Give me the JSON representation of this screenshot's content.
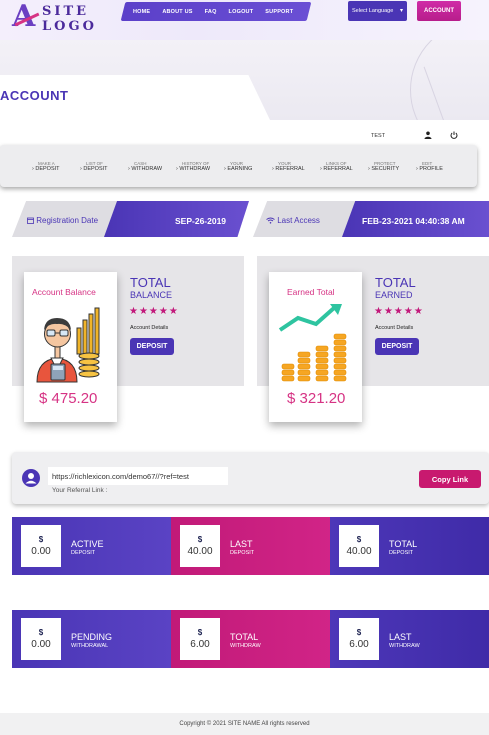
{
  "logo": {
    "mark": "A",
    "line1": "SITE",
    "line2": "LOGO"
  },
  "nav": [
    "HOME",
    "ABOUT US",
    "FAQ",
    "LOGOUT",
    "SUPPORT"
  ],
  "language": {
    "label": "Select Language",
    "caret": "▾"
  },
  "account_button": "ACCOUNT",
  "page_title": "ACCOUNT",
  "user": {
    "name": "TEST",
    "user_icon": "user-icon",
    "power_icon": "power-icon"
  },
  "submenu": [
    {
      "top": "MAKE A",
      "label": "DEPOSIT"
    },
    {
      "top": "LIST OF",
      "label": "DEPOSIT"
    },
    {
      "top": "CASH",
      "label": "WITHDRAW"
    },
    {
      "top": "HISTORY OF",
      "label": "WITHDRAW"
    },
    {
      "top": "YOUR",
      "label": "EARNING"
    },
    {
      "top": "YOUR",
      "label": "REFERRAL"
    },
    {
      "top": "LINKS OF",
      "label": "REFERRAL"
    },
    {
      "top": "PROTECT",
      "label": "SECURITY"
    },
    {
      "top": "EDIT",
      "label": "PROFILE"
    }
  ],
  "registration": {
    "label": "Registration Date",
    "value": "SEP-26-2019"
  },
  "last_access": {
    "label": "Last Access",
    "value": "FEB-23-2021 04:40:38 AM"
  },
  "balance_card": {
    "label": "Account Balance",
    "amount": "$ 475.20",
    "title": "TOTAL",
    "sub": "BALANCE",
    "stars": "★★★★★",
    "details": "Account Details",
    "button": "DEPOSIT"
  },
  "earned_card": {
    "label": "Earned Total",
    "amount": "$ 321.20",
    "title": "TOTAL",
    "sub": "EARNED",
    "stars": "★★★★★",
    "details": "Account Details",
    "button": "DEPOSIT"
  },
  "referral": {
    "url": "https://richlexicon.com/demo67//?ref=test",
    "label": "Your Referral Link :",
    "copy_button": "Copy Link"
  },
  "stats_row1": [
    {
      "currency": "$",
      "value": "0.00",
      "name": "ACTIVE",
      "desc": "DEPOSIT"
    },
    {
      "currency": "$",
      "value": "40.00",
      "name": "LAST",
      "desc": "DEPOSIT"
    },
    {
      "currency": "$",
      "value": "40.00",
      "name": "TOTAL",
      "desc": "DEPOSIT"
    }
  ],
  "stats_row2": [
    {
      "currency": "$",
      "value": "0.00",
      "name": "PENDING",
      "desc": "WITHDRAWAL"
    },
    {
      "currency": "$",
      "value": "6.00",
      "name": "TOTAL",
      "desc": "WITHDRAW"
    },
    {
      "currency": "$",
      "value": "6.00",
      "name": "LAST",
      "desc": "WITHDRAW"
    }
  ],
  "footer": "Copyright © 2021 SITE NAME All rights reserved",
  "colors": {
    "primary": "#4a35b5",
    "accent": "#d63384",
    "pink": "#c11a78"
  }
}
